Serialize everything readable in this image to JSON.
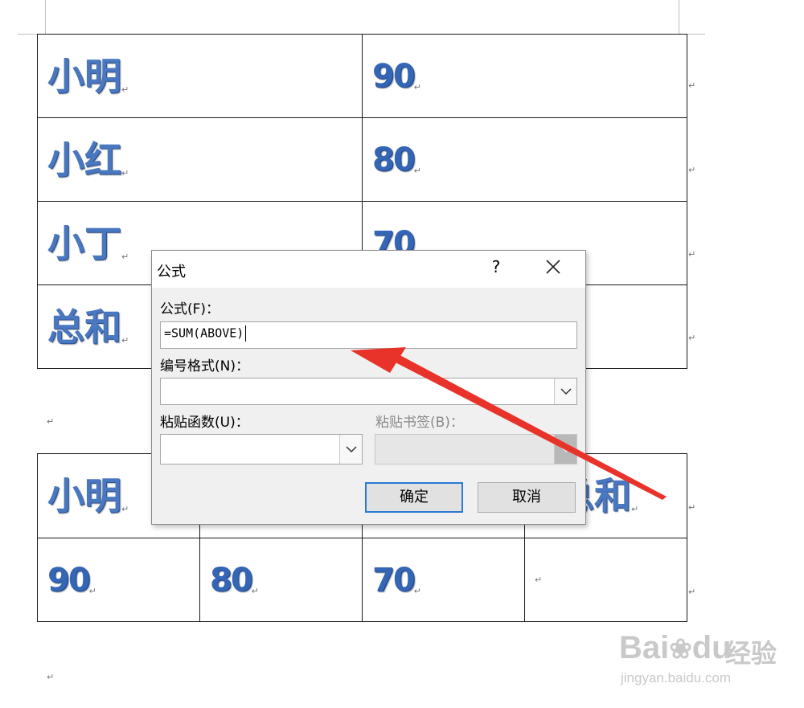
{
  "table1": {
    "rows": [
      {
        "name": "小明",
        "score": "90"
      },
      {
        "name": "小红",
        "score": "80"
      },
      {
        "name": "小丁",
        "score": "70"
      },
      {
        "name": "总和",
        "score": ""
      }
    ]
  },
  "table2": {
    "header": [
      "小明",
      "",
      "",
      "总和"
    ],
    "values": [
      "90",
      "80",
      "70",
      ""
    ]
  },
  "paragraph_mark": "↵",
  "dialog": {
    "title": "公式",
    "help": "?",
    "close": "✕",
    "formula_label": "公式(F)：",
    "formula_value": "=SUM(ABOVE)",
    "number_format_label": "编号格式(N)：",
    "number_format_value": "",
    "paste_function_label": "粘贴函数(U)：",
    "paste_function_value": "",
    "paste_bookmark_label": "粘贴书签(B)：",
    "paste_bookmark_value": "",
    "ok_label": "确定",
    "cancel_label": "取消"
  },
  "annotation": {
    "arrow_color": "#e8332a"
  },
  "watermark": {
    "brand": "Bai",
    "brand2": "du",
    "cn": "经验",
    "url": "jingyan.baidu.com"
  }
}
